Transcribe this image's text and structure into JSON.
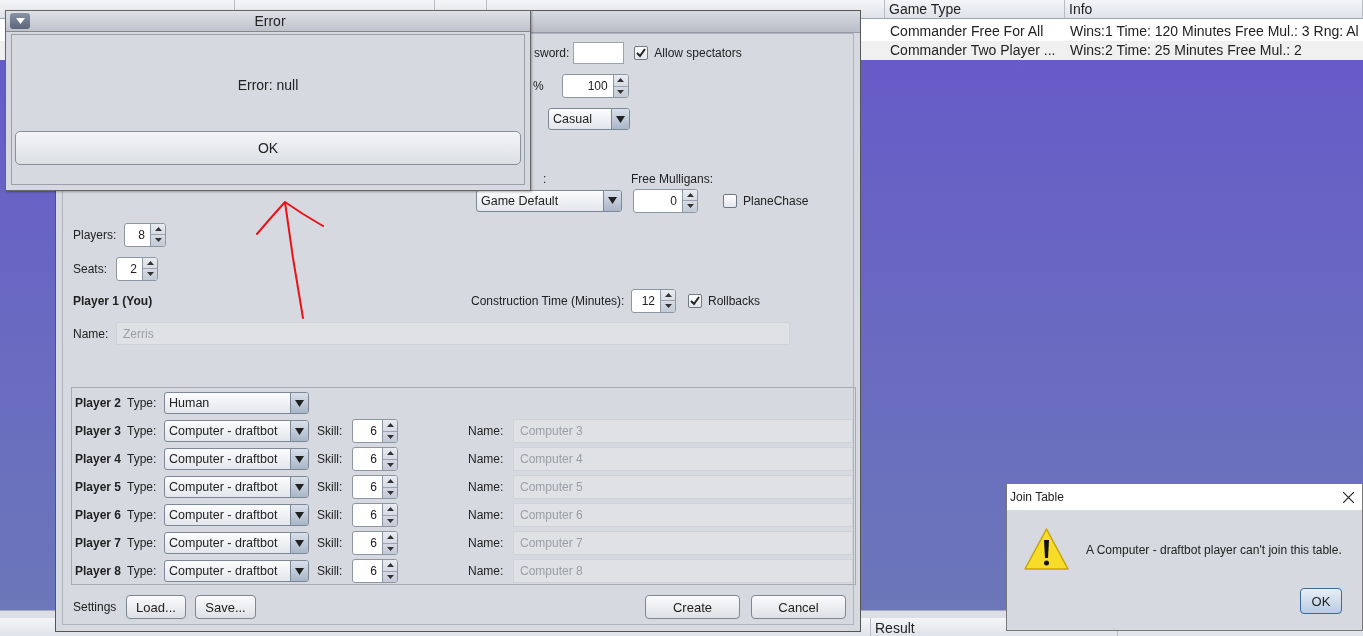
{
  "games_table": {
    "columns": [
      {
        "label": "Game Type"
      },
      {
        "label": "Info"
      }
    ],
    "rows": [
      {
        "game_type": "Commander Free For All",
        "info": "Wins:1 Time: 120 Minutes Free Mul.: 3 Rng: Al"
      },
      {
        "game_type": "Commander Two Player ...",
        "info": "Wins:2 Time: 25 Minutes Free Mul.: 2"
      }
    ]
  },
  "results_table": {
    "columns": [
      "Result"
    ]
  },
  "new_table_dialog": {
    "password_label": "sword:",
    "allow_spectators": {
      "label": "Allow spectators",
      "checked": true
    },
    "percent_label": "%",
    "percent": "100",
    "game_mode": "Casual",
    "mulligan_label": ":",
    "mulligan_type": "Game Default",
    "free_mulligans_label": "Free Mulligans:",
    "free_mulligans": "0",
    "planechase": {
      "label": "PlaneChase",
      "checked": false
    },
    "players_label": "Players:",
    "players": "8",
    "seats_label": "Seats:",
    "seats": "2",
    "player1": {
      "label": "Player 1 (You)",
      "name_label": "Name:",
      "name": "Zerris",
      "disabled": true
    },
    "construction_time": {
      "label": "Construction Time (Minutes):",
      "value": "12"
    },
    "rollbacks": {
      "label": "Rollbacks",
      "checked": true
    },
    "opponents": [
      {
        "kind": "human",
        "label": "Player 2",
        "type_label": "Type:",
        "type": "Human"
      },
      {
        "kind": "computer",
        "label": "Player 3",
        "type_label": "Type:",
        "type": "Computer - draftbot",
        "skill_label": "Skill:",
        "skill": "6",
        "name_label": "Name:",
        "name": "Computer 3",
        "disabled": true
      },
      {
        "kind": "computer",
        "label": "Player 4",
        "type_label": "Type:",
        "type": "Computer - draftbot",
        "skill_label": "Skill:",
        "skill": "6",
        "name_label": "Name:",
        "name": "Computer 4",
        "disabled": true
      },
      {
        "kind": "computer",
        "label": "Player 5",
        "type_label": "Type:",
        "type": "Computer - draftbot",
        "skill_label": "Skill:",
        "skill": "6",
        "name_label": "Name:",
        "name": "Computer 5",
        "disabled": true
      },
      {
        "kind": "computer",
        "label": "Player 6",
        "type_label": "Type:",
        "type": "Computer - draftbot",
        "skill_label": "Skill:",
        "skill": "6",
        "name_label": "Name:",
        "name": "Computer 6",
        "disabled": true
      },
      {
        "kind": "computer",
        "label": "Player 7",
        "type_label": "Type:",
        "type": "Computer - draftbot",
        "skill_label": "Skill:",
        "skill": "6",
        "name_label": "Name:",
        "name": "Computer 7",
        "disabled": true
      },
      {
        "kind": "computer",
        "label": "Player 8",
        "type_label": "Type:",
        "type": "Computer - draftbot",
        "skill_label": "Skill:",
        "skill": "6",
        "name_label": "Name:",
        "name": "Computer 8",
        "disabled": true
      }
    ],
    "settings_label": "Settings",
    "settings_buttons": [
      "Load...",
      "Save..."
    ],
    "action_buttons": [
      "Create",
      "Cancel"
    ]
  },
  "error_dialog": {
    "title": "Error",
    "message": "Error: null",
    "button": "OK"
  },
  "join_dialog": {
    "title": "Join Table",
    "message": "A Computer - draftbot player can't join this table.",
    "button": "OK"
  }
}
